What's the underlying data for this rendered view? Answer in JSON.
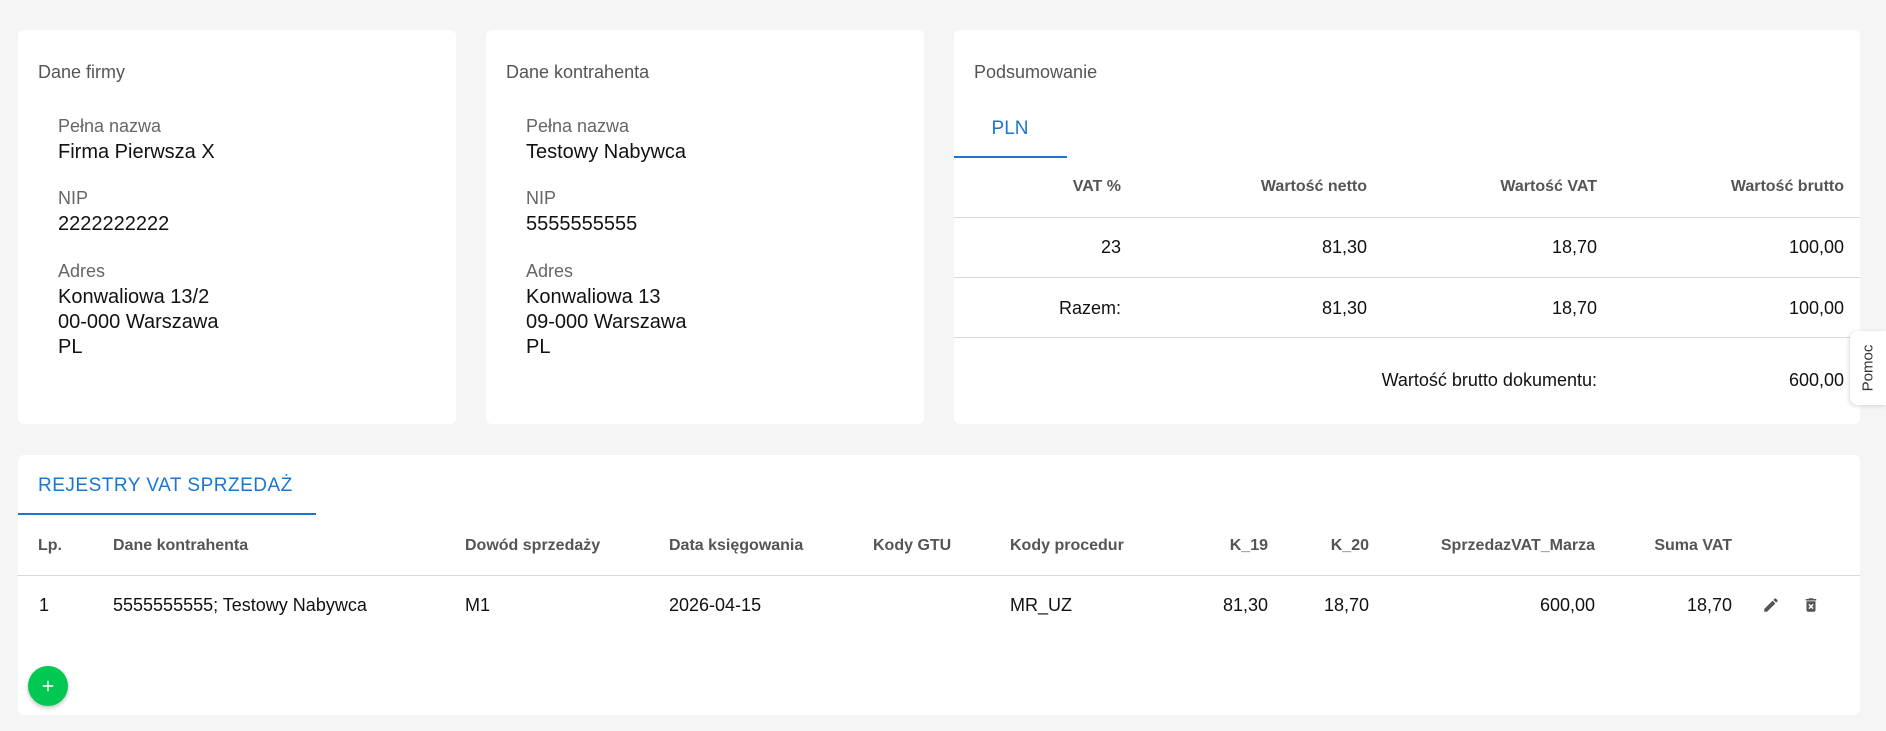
{
  "company": {
    "title": "Dane firmy",
    "name_label": "Pełna nazwa",
    "name": "Firma Pierwsza X",
    "nip_label": "NIP",
    "nip": "2222222222",
    "address_label": "Adres",
    "address_line1": "Konwaliowa 13/2",
    "address_line2": "00-000 Warszawa",
    "address_line3": "PL"
  },
  "contractor": {
    "title": "Dane kontrahenta",
    "name_label": "Pełna nazwa",
    "name": "Testowy Nabywca",
    "nip_label": "NIP",
    "nip": "5555555555",
    "address_label": "Adres",
    "address_line1": "Konwaliowa 13",
    "address_line2": "09-000 Warszawa",
    "address_line3": "PL"
  },
  "summary": {
    "title": "Podsumowanie",
    "tab": "PLN",
    "headers": {
      "vat": "VAT %",
      "netto": "Wartość netto",
      "vat_value": "Wartość VAT",
      "brutto": "Wartość brutto"
    },
    "rows": [
      {
        "vat": "23",
        "netto": "81,30",
        "vat_value": "18,70",
        "brutto": "100,00"
      },
      {
        "vat": "Razem:",
        "netto": "81,30",
        "vat_value": "18,70",
        "brutto": "100,00"
      }
    ],
    "doc_brutto_label": "Wartość brutto dokumentu:",
    "doc_brutto_value": "600,00"
  },
  "help": {
    "label": "Pomoc"
  },
  "registers": {
    "tab": "REJESTRY VAT SPRZEDAŻ",
    "headers": {
      "lp": "Lp.",
      "contractor": "Dane kontrahenta",
      "proof": "Dowód sprzedaży",
      "date": "Data księgowania",
      "gtu": "Kody GTU",
      "procedures": "Kody procedur",
      "k19": "K_19",
      "k20": "K_20",
      "marza": "SprzedazVAT_Marza",
      "suma_vat": "Suma VAT"
    },
    "rows": [
      {
        "lp": "1",
        "contractor": "5555555555; Testowy Nabywca",
        "proof": "M1",
        "date": "2026-04-15",
        "gtu": "",
        "procedures": "MR_UZ",
        "k19": "81,30",
        "k20": "18,70",
        "marza": "600,00",
        "suma_vat": "18,70"
      }
    ]
  },
  "colors": {
    "accent": "#1976d2",
    "fab": "#00c853"
  },
  "icons": {
    "edit": "pencil-icon",
    "delete": "trash-icon",
    "add": "plus-icon"
  }
}
